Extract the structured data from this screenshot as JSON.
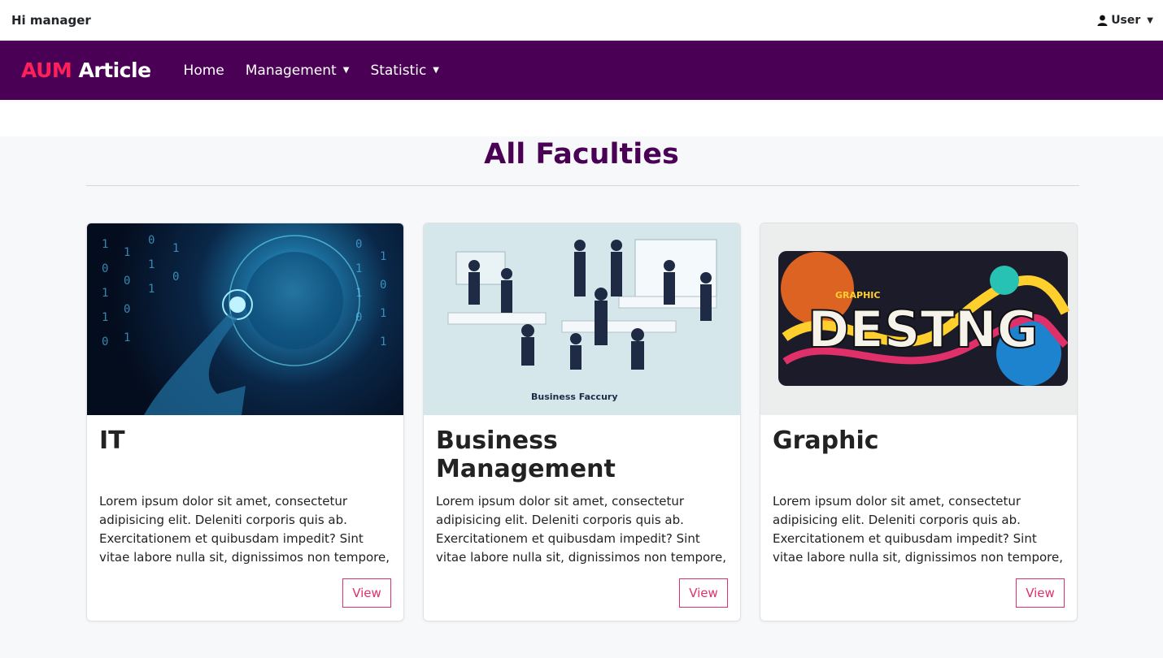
{
  "topbar": {
    "greeting": "Hi manager",
    "user_label": "User"
  },
  "navbar": {
    "brand_accent": "AUM",
    "brand_rest": "Article",
    "items": [
      {
        "label": "Home",
        "has_dropdown": false
      },
      {
        "label": "Management",
        "has_dropdown": true
      },
      {
        "label": "Statistic",
        "has_dropdown": true
      }
    ]
  },
  "main": {
    "title": "All Faculties",
    "cards": [
      {
        "title": "IT",
        "description": "Lorem ipsum dolor sit amet, consectetur adipisicing elit. Deleniti corporis quis ab. Exercitationem et quibusdam impedit? Sint vitae labore nulla sit, dignissimos non tempore,",
        "button": "View",
        "image": "it-faculty-image"
      },
      {
        "title": "Business Management",
        "description": "Lorem ipsum dolor sit amet, consectetur adipisicing elit. Deleniti corporis quis ab. Exercitationem et quibusdam impedit? Sint vitae labore nulla sit, dignissimos non tempore,",
        "button": "View",
        "image": "business-faculty-image",
        "image_caption": "Business Faccury"
      },
      {
        "title": "Graphic",
        "description": "Lorem ipsum dolor sit amet, consectetur adipisicing elit. Deleniti corporis quis ab. Exercitationem et quibusdam impedit? Sint vitae labore nulla sit, dignissimos non tempore,",
        "button": "View",
        "image": "graphic-faculty-image",
        "image_text": "DESTNG",
        "image_subtext": "GRAPHIC"
      }
    ]
  },
  "colors": {
    "navbar_bg": "#4a0054",
    "brand_accent": "#ff1f5a",
    "title": "#4a0054",
    "button": "#e0306a"
  }
}
